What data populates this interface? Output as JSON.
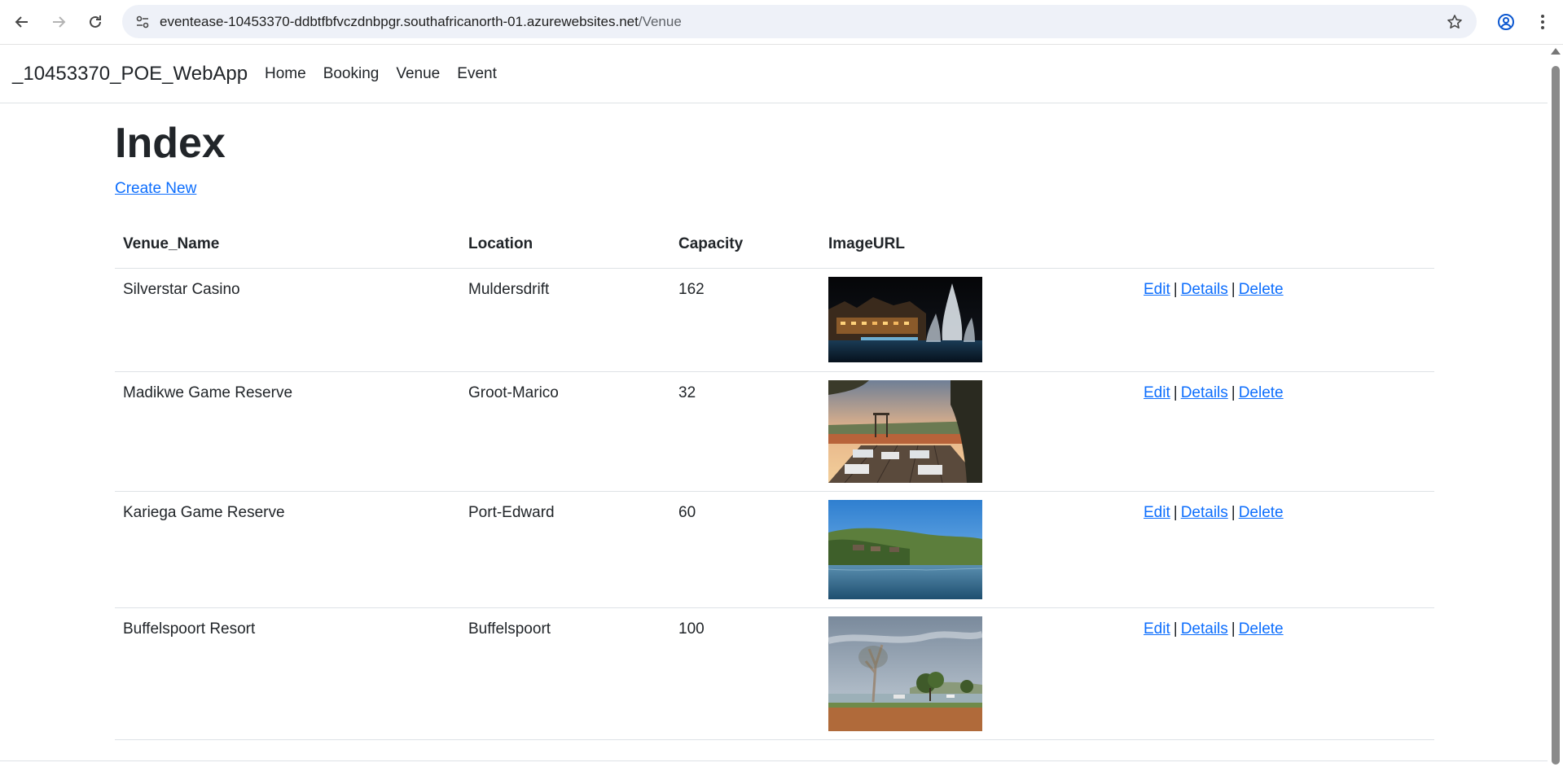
{
  "browser": {
    "url_host": "eventease-10453370-ddbtfbfvczdnbpgr.southafricanorth-01.azurewebsites.net",
    "url_path": "/Venue"
  },
  "navbar": {
    "brand": "_10453370_POE_WebApp",
    "links": [
      "Home",
      "Booking",
      "Venue",
      "Event"
    ]
  },
  "page": {
    "title": "Index",
    "create_link": "Create New"
  },
  "table": {
    "headers": [
      "Venue_Name",
      "Location",
      "Capacity",
      "ImageURL",
      ""
    ],
    "rows": [
      {
        "name": "Silverstar Casino",
        "location": "Muldersdrift",
        "capacity": "162",
        "image": "night-casino-fountain"
      },
      {
        "name": "Madikwe Game Reserve",
        "location": "Groot-Marico",
        "capacity": "32",
        "image": "sunset-deck-dining"
      },
      {
        "name": "Kariega Game Reserve",
        "location": "Port-Edward",
        "capacity": "60",
        "image": "river-lodge"
      },
      {
        "name": "Buffelspoort Resort",
        "location": "Buffelspoort",
        "capacity": "100",
        "image": "trees-grassland"
      }
    ],
    "actions": {
      "edit": "Edit",
      "details": "Details",
      "delete": "Delete",
      "separator": "|"
    }
  }
}
